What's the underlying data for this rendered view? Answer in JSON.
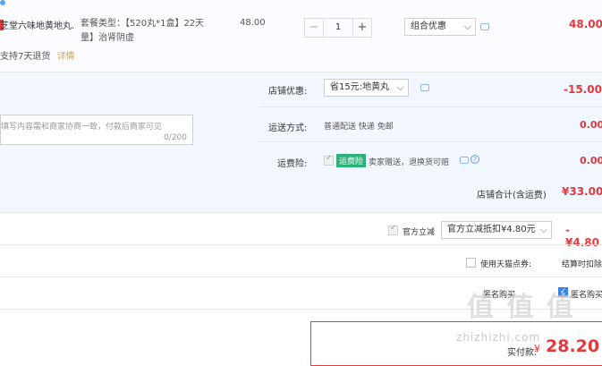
{
  "product": {
    "name": "芝堂六味地黄地丸...",
    "spec": "套餐类型：【520丸*1盒】22天量】治肾阴虚",
    "price": "48.00",
    "quantity": "1",
    "promo_select": "组合优惠",
    "subtotal": "48.00",
    "return_policy": "支持7天退货",
    "details_link": "详情"
  },
  "shop": {
    "discount_label": "店铺优惠:",
    "discount_select": "省15元:地黄丸",
    "discount_amount": "-15.00",
    "message_placeholder": "填写内容需和商家协商一致，付款后商家可见",
    "message_counter": "0/200",
    "shipping_label": "运送方式:",
    "shipping_value": "普通配送 快递 免邮",
    "shipping_amount": "0.00",
    "insurance_label": "运费险:",
    "insurance_badge": "运费险",
    "insurance_text": "卖家赠送，退换货可赔",
    "insurance_amount": "0.00",
    "total_label": "店铺合计(含运费)",
    "total_amount": "¥33.00"
  },
  "official": {
    "label": "官方立减",
    "select": "官方立减抵扣¥4.80元",
    "amount": "-¥4.80"
  },
  "tmall_points": {
    "label": "使用天猫点券:",
    "right_text": "结算时扣除"
  },
  "anonymous": {
    "label": "匿名购买",
    "text": "匿名购买"
  },
  "payment": {
    "label": "实付款:",
    "currency": "¥",
    "amount": "28.20"
  },
  "watermark": {
    "text": "值 值 值",
    "url": "zhizhizhi.com"
  }
}
